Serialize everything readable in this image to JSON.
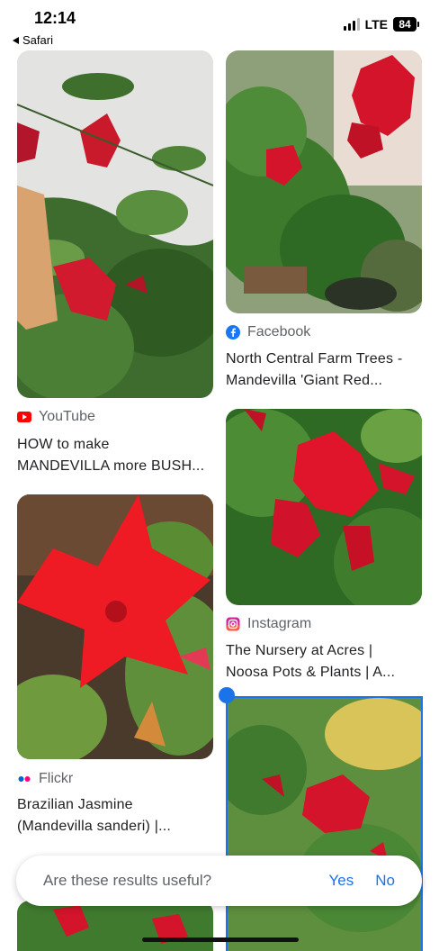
{
  "status_bar": {
    "time": "12:14",
    "back_app": "Safari",
    "network": "LTE",
    "battery": "84"
  },
  "results": [
    {
      "source": "YouTube",
      "title_line1": "HOW to make",
      "title_line2": "MANDEVILLA more BUSH...",
      "icon": "youtube-icon"
    },
    {
      "source": "Facebook",
      "title_line1": "North Central Farm Trees -",
      "title_line2": "Mandevilla 'Giant Red...",
      "icon": "facebook-icon"
    },
    {
      "source": "Flickr",
      "title_line1": "Brazilian Jasmine",
      "title_line2": "(Mandevilla sanderi) |...",
      "icon": "flickr-icon"
    },
    {
      "source": "Instagram",
      "title_line1": "The Nursery at Acres |",
      "title_line2": "Noosa Pots & Plants | A...",
      "icon": "instagram-icon"
    }
  ],
  "feedback": {
    "question": "Are these results useful?",
    "yes": "Yes",
    "no": "No"
  },
  "colors": {
    "accent": "#1a73e8",
    "flower_red": "#d3142a",
    "leaf_green": "#3d7a2c"
  }
}
